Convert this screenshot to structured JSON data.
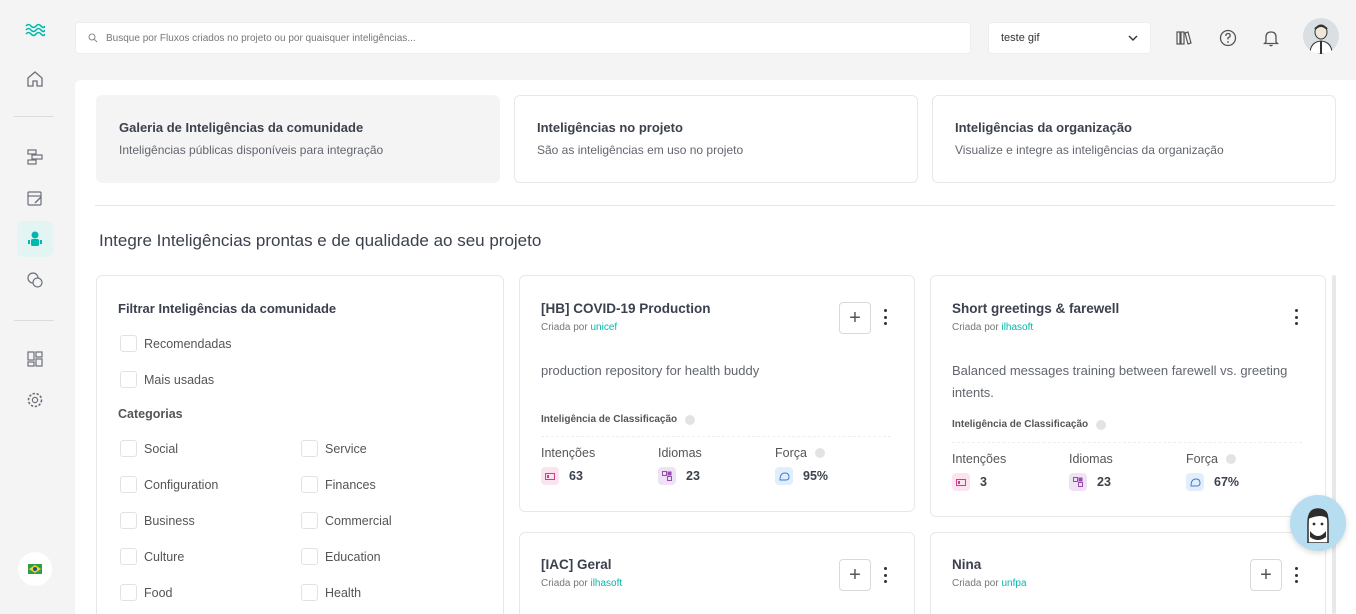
{
  "search": {
    "placeholder": "Busque por Fluxos criados no projeto ou por quaisquer inteligências..."
  },
  "project_select": {
    "value": "teste gif"
  },
  "tabs": [
    {
      "title": "Galeria de Inteligências da comunidade",
      "subtitle": "Inteligências públicas disponíveis para integração"
    },
    {
      "title": "Inteligências no projeto",
      "subtitle": "São as inteligências em uso no projeto"
    },
    {
      "title": "Inteligências da organização",
      "subtitle": "Visualize e integre as inteligências da organização"
    }
  ],
  "heading": "Integre Inteligências prontas e de qualidade ao seu projeto",
  "filter": {
    "title": "Filtrar Inteligências da comunidade",
    "options": [
      "Recomendadas",
      "Mais usadas"
    ],
    "categories_label": "Categorias",
    "categories_left": [
      "Social",
      "Configuration",
      "Business",
      "Culture",
      "Food"
    ],
    "categories_right": [
      "Service",
      "Finances",
      "Commercial",
      "Education",
      "Health"
    ]
  },
  "card_labels": {
    "created_by": "Criada por",
    "type": "Inteligência de Classificação",
    "intents": "Intenções",
    "languages": "Idiomas",
    "strength": "Força"
  },
  "cards": [
    {
      "title": "[HB] COVID-19 Production",
      "owner": "unicef",
      "description": "production repository for health buddy",
      "intents": "63",
      "languages": "23",
      "strength": "95%"
    },
    {
      "title": "Short greetings & farewell",
      "owner": "ilhasoft",
      "description": "Balanced messages training between farewell vs. greeting intents.",
      "intents": "3",
      "languages": "23",
      "strength": "67%"
    },
    {
      "title": "[IAC] Geral",
      "owner": "ilhasoft"
    },
    {
      "title": "Nina",
      "owner": "unfpa"
    }
  ],
  "colors": {
    "accent": "#00b9ae",
    "text": "#3b414d",
    "background": "#f4f4f4"
  }
}
